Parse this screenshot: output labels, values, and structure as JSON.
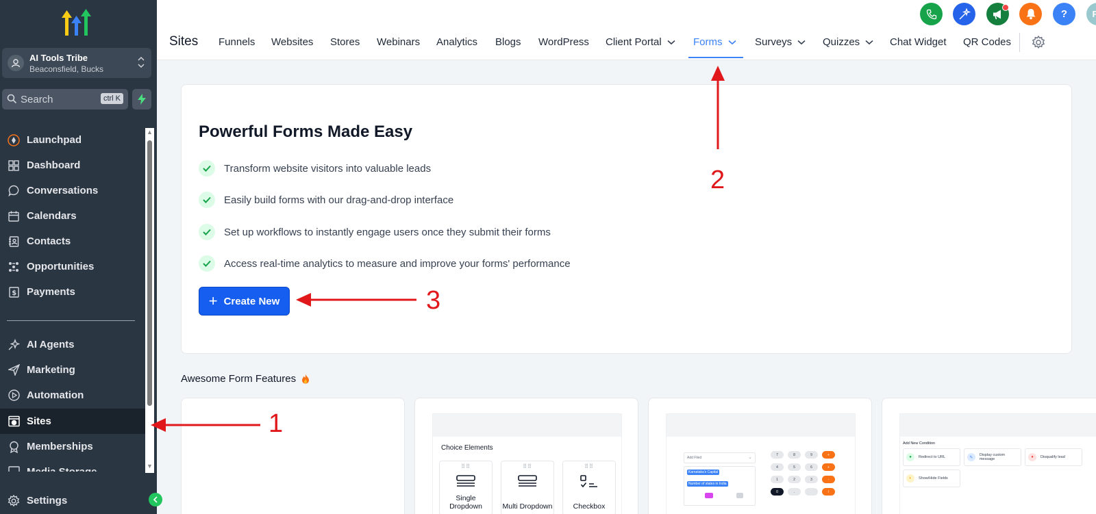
{
  "account": {
    "name": "AI Tools Tribe",
    "location": "Beaconsfield, Bucks"
  },
  "search": {
    "placeholder": "Search",
    "shortcut": "ctrl K"
  },
  "sidebar": {
    "items": [
      {
        "label": "Launchpad",
        "icon": "rocket-icon"
      },
      {
        "label": "Dashboard",
        "icon": "grid-icon"
      },
      {
        "label": "Conversations",
        "icon": "chat-icon"
      },
      {
        "label": "Calendars",
        "icon": "calendar-icon"
      },
      {
        "label": "Contacts",
        "icon": "contacts-icon"
      },
      {
        "label": "Opportunities",
        "icon": "opportunities-icon"
      },
      {
        "label": "Payments",
        "icon": "payments-icon"
      },
      {
        "label": "AI Agents",
        "icon": "sparkle-icon"
      },
      {
        "label": "Marketing",
        "icon": "send-icon"
      },
      {
        "label": "Automation",
        "icon": "play-circle-icon"
      },
      {
        "label": "Sites",
        "icon": "sites-icon",
        "active": true
      },
      {
        "label": "Memberships",
        "icon": "award-icon"
      },
      {
        "label": "Media Storage",
        "icon": "media-icon"
      }
    ],
    "settings_label": "Settings"
  },
  "header": {
    "title": "Sites",
    "tabs": [
      {
        "label": "Funnels"
      },
      {
        "label": "Websites"
      },
      {
        "label": "Stores"
      },
      {
        "label": "Webinars"
      },
      {
        "label": "Analytics"
      },
      {
        "label": "Blogs"
      },
      {
        "label": "WordPress"
      },
      {
        "label": "Client Portal",
        "dropdown": true
      },
      {
        "label": "Forms",
        "dropdown": true,
        "active": true
      },
      {
        "label": "Surveys",
        "dropdown": true
      },
      {
        "label": "Quizzes",
        "dropdown": true
      },
      {
        "label": "Chat Widget"
      },
      {
        "label": "QR Codes"
      }
    ],
    "user_initials": "FF",
    "help_label": "?"
  },
  "hero": {
    "title": "Powerful Forms Made Easy",
    "features": [
      "Transform website visitors into valuable leads",
      "Easily build forms with our drag-and-drop interface",
      "Set up workflows to instantly engage users once they submit their forms",
      "Access real-time analytics to measure and improve your forms' performance"
    ],
    "create_label": "Create New"
  },
  "features_section": {
    "title": "Awesome Form Features",
    "choice_elements_title": "Choice Elements",
    "choices": [
      "Single Dropdown",
      "Multi Dropdown",
      "Checkbox"
    ],
    "calc_field_placeholder": "Add Filed",
    "calc_chips": [
      "Karnataka's Capital",
      "Number of states in India"
    ],
    "calc_keys": [
      "7",
      "8",
      "9",
      "+",
      "4",
      "5",
      "6",
      "+",
      "1",
      "2",
      "3",
      "-",
      "0",
      ".",
      "/"
    ],
    "conditions_title": "Add New Condition",
    "conditions": [
      "Redirect to URL",
      "Display custom message",
      "Disqualify lead",
      "Show/Hide Fields"
    ]
  },
  "annotations": {
    "one": "1",
    "two": "2",
    "three": "3"
  },
  "colors": {
    "sidebar": "#2b3643",
    "accent": "#155eef",
    "active_tab": "#3b82f6",
    "arrow": "#e0181b"
  }
}
